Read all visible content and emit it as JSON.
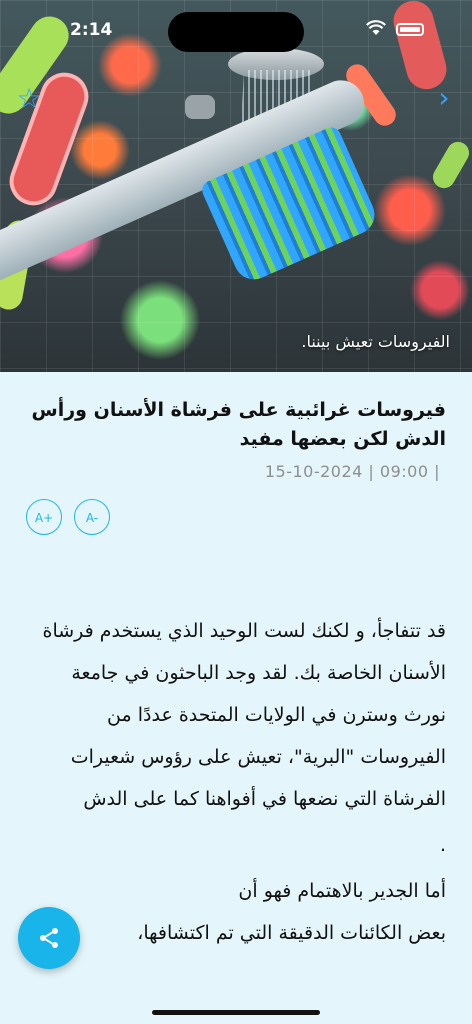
{
  "status_bar": {
    "time": "2:14"
  },
  "hero": {
    "caption": "الفيروسات تعيش بيننا.",
    "star_icon": "star-outline-icon",
    "back_icon": "chevron-right-icon"
  },
  "article": {
    "title": "فيروسات غرائبية على فرشاة الأسنان ورأس الدش لكن بعضها مفيد",
    "meta": "15-10-2024 | 09:00 |",
    "font_increase_label": "A+",
    "font_decrease_label": "A-",
    "paragraphs": [
      "قد تتفاجأ، و لكنك لست الوحيد الذي يستخدم فرشاة الأسنان الخاصة بك. لقد وجد الباحثون في جامعة نورث وسترن في الولايات المتحدة عددًا من الفيروسات \"البرية\"، تعيش على رؤوس شعيرات الفرشاة التي نضعها في أفواهنا كما على الدش",
      ".",
      "أما الجدير بالاهتمام فهو أن",
      "بعض الكائنات الدقيقة التي تم اكتشافها،"
    ]
  },
  "share": {
    "icon": "share-icon"
  },
  "colors": {
    "accent": "#1fb6e6",
    "background": "#e4f6fb"
  }
}
